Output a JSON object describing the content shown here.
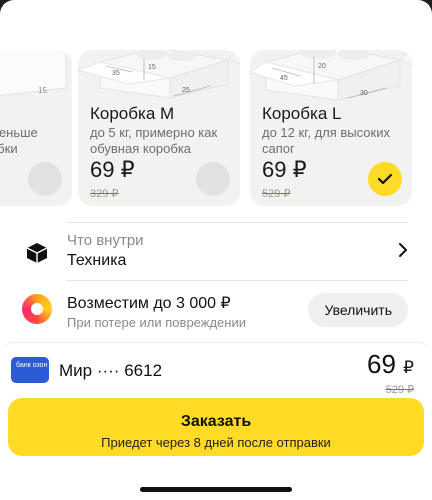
{
  "box_cards": [
    {
      "id": "s",
      "name": "",
      "desc_lines": [
        "меньше",
        "обки"
      ],
      "dims": [
        "15"
      ],
      "price": "",
      "old_price": "",
      "selected": false
    },
    {
      "id": "m",
      "name": "Коробка М",
      "description": "до 5 кг, примерно как обувная коробка",
      "dims": [
        "35",
        "15",
        "25"
      ],
      "price": "69 ₽",
      "old_price": "329 ₽",
      "selected": false
    },
    {
      "id": "l",
      "name": "Коробка L",
      "description": "до 12 кг, для высоких сапог",
      "dims": [
        "45",
        "20",
        "30"
      ],
      "price": "69 ₽",
      "old_price": "529 ₽",
      "selected": true
    }
  ],
  "contents_row": {
    "label": "Что внутри",
    "value": "Техника",
    "icon": "cube-icon"
  },
  "insurance_row": {
    "title": "Возместим до 3 000 ₽",
    "subtitle": "При потере или повреждении",
    "button_label": "Увеличить",
    "icon": "insurance-icon"
  },
  "payment": {
    "bank_logo_text": "банк озон",
    "card_label": "Мир ···· 6612",
    "total": "69",
    "currency": "₽",
    "old_total": "529 ₽"
  },
  "order_button": {
    "label": "Заказать",
    "sublabel": "Приедет через 8 дней после отправки"
  },
  "colors": {
    "accent_yellow": "#ffdb26",
    "card_bg": "#f2f2f0",
    "bank_blue": "#2d5bd6",
    "strike_red": "#e04a3a"
  }
}
